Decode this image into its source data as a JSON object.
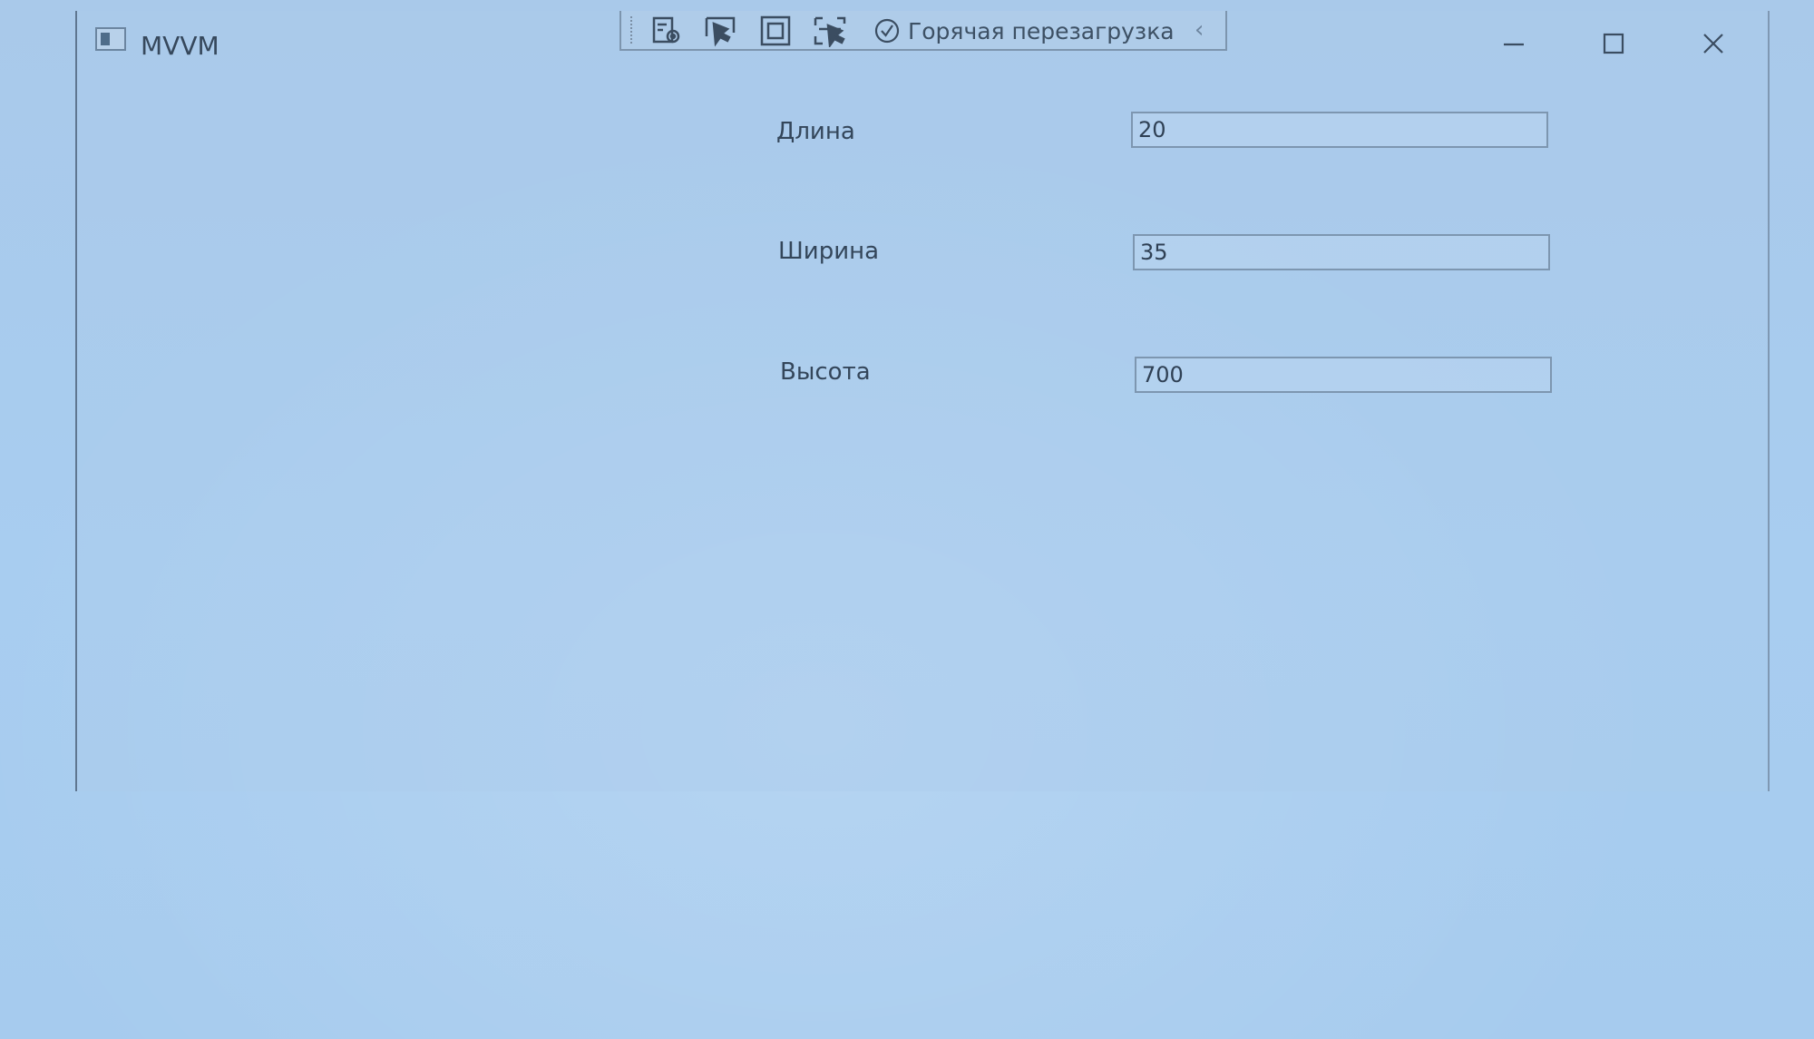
{
  "window": {
    "title": "MVVM",
    "icon": "window-app-icon",
    "controls": {
      "minimize_icon": "minimize-icon",
      "maximize_icon": "maximize-icon",
      "close_icon": "close-icon"
    }
  },
  "devtools": {
    "tools": [
      {
        "name": "live-visual-tree-icon"
      },
      {
        "name": "select-element-icon"
      },
      {
        "name": "display-layout-adorners-icon"
      },
      {
        "name": "track-focused-element-icon"
      }
    ],
    "hot_reload_label": "Горячая перезагрузка",
    "status_icon": "check-circle-icon",
    "collapse_glyph": "‹"
  },
  "form": {
    "fields": [
      {
        "label": "Длина",
        "value": "20"
      },
      {
        "label": "Ширина",
        "value": "35"
      },
      {
        "label": "Высота",
        "value": "700"
      }
    ]
  },
  "colors": {
    "background": "#a8cdf0",
    "text": "#34465a",
    "border": "#7d96b0"
  }
}
